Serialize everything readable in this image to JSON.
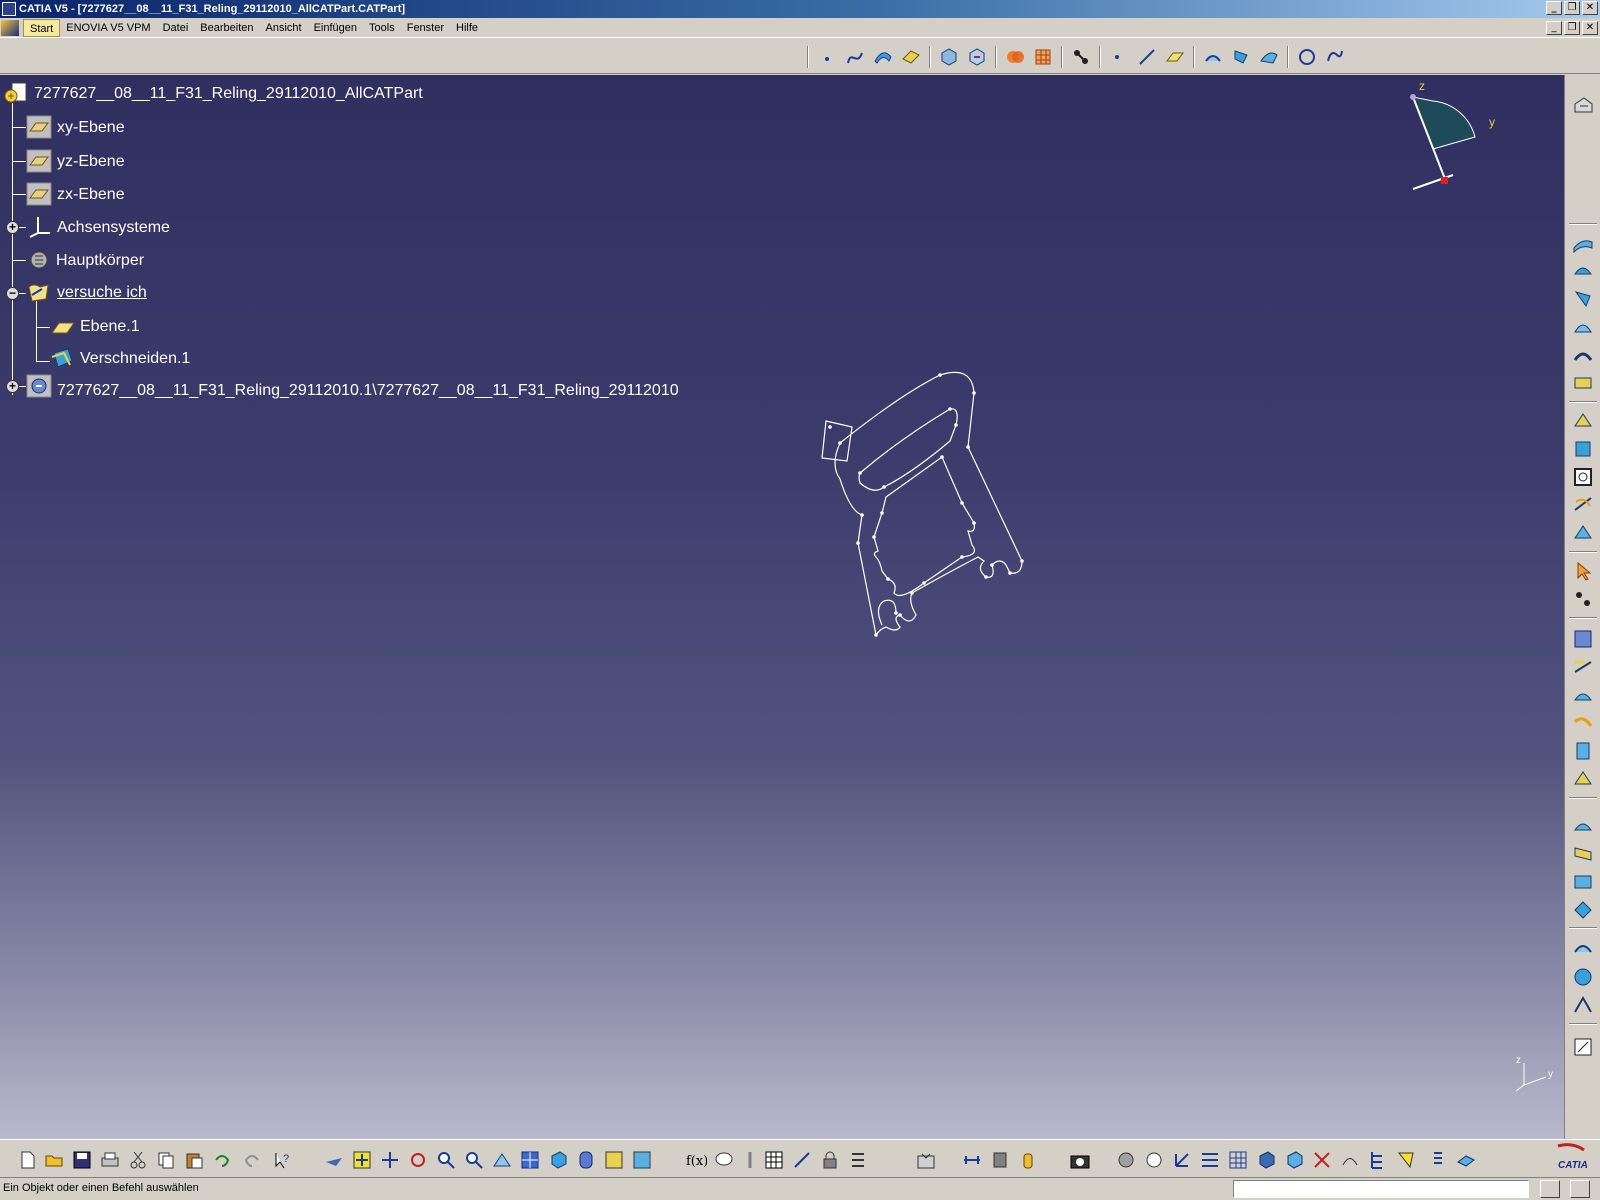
{
  "window": {
    "title": "CATIA V5 - [7277627__08__11_F31_Reling_29112010_AllCATPart.CATPart]",
    "minimize": "_",
    "maximize": "❐",
    "close": "✕"
  },
  "menubar": {
    "items": [
      "Start",
      "ENOVIA V5 VPM",
      "Datei",
      "Bearbeiten",
      "Ansicht",
      "Einfügen",
      "Tools",
      "Fenster",
      "Hilfe"
    ]
  },
  "tree": {
    "root": "7277627__08__11_F31_Reling_29112010_AllCATPart",
    "items": [
      {
        "label": "xy-Ebene",
        "icon": "plane-icon"
      },
      {
        "label": "yz-Ebene",
        "icon": "plane-icon"
      },
      {
        "label": "zx-Ebene",
        "icon": "plane-icon"
      },
      {
        "label": "Achsensysteme",
        "icon": "axis-system-icon"
      },
      {
        "label": "Hauptkörper",
        "icon": "part-body-icon"
      },
      {
        "label": "versuche ich",
        "icon": "geometrical-set-icon"
      },
      {
        "label": "Ebene.1",
        "icon": "plane-feature-icon"
      },
      {
        "label": "Verschneiden.1",
        "icon": "intersection-icon"
      },
      {
        "label": "7277627__08__11_F31_Reling_29112010.1\\7277627__08__11_F31_Reling_29112010",
        "icon": "external-reference-icon"
      }
    ],
    "expanders": {
      "collapsed": "+",
      "expanded": "−"
    }
  },
  "compass": {
    "z_label": "z",
    "y_label": "y"
  },
  "mini_axis": {
    "z_label": "z",
    "y_label": "y"
  },
  "status": {
    "prompt": "Ein Objekt oder einen Befehl auswählen",
    "command_value": ""
  },
  "brand": {
    "logo_text": "CATIA"
  }
}
